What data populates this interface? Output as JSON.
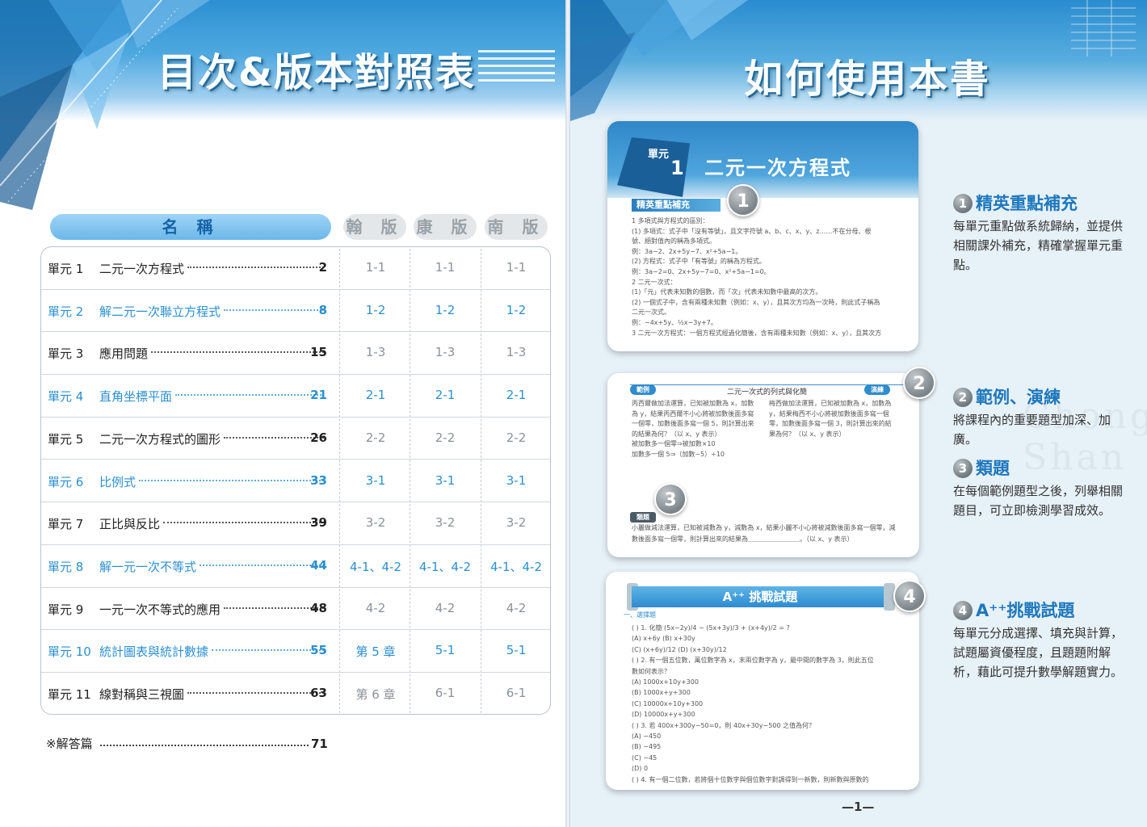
{
  "left_page": {
    "title": "目次&版本對照表",
    "headers": {
      "name": "名 稱",
      "versions": [
        "翰 版",
        "康 版",
        "南 版"
      ]
    },
    "rows": [
      {
        "unit": "單元 1",
        "title": "二元一次方程式",
        "page": "2",
        "v1": "1-1",
        "v2": "1-1",
        "v3": "1-1",
        "blue": false
      },
      {
        "unit": "單元 2",
        "title": "解二元一次聯立方程式",
        "page": "8",
        "v1": "1-2",
        "v2": "1-2",
        "v3": "1-2",
        "blue": true
      },
      {
        "unit": "單元 3",
        "title": "應用問題",
        "page": "15",
        "v1": "1-3",
        "v2": "1-3",
        "v3": "1-3",
        "blue": false
      },
      {
        "unit": "單元 4",
        "title": "直角坐標平面",
        "page": "21",
        "v1": "2-1",
        "v2": "2-1",
        "v3": "2-1",
        "blue": true
      },
      {
        "unit": "單元 5",
        "title": "二元一次方程式的圖形",
        "page": "26",
        "v1": "2-2",
        "v2": "2-2",
        "v3": "2-2",
        "blue": false
      },
      {
        "unit": "單元 6",
        "title": "比例式",
        "page": "33",
        "v1": "3-1",
        "v2": "3-1",
        "v3": "3-1",
        "blue": true
      },
      {
        "unit": "單元 7",
        "title": "正比與反比",
        "page": "39",
        "v1": "3-2",
        "v2": "3-2",
        "v3": "3-2",
        "blue": false
      },
      {
        "unit": "單元 8",
        "title": "解一元一次不等式",
        "page": "44",
        "v1": "4-1、4-2",
        "v2": "4-1、4-2",
        "v3": "4-1、4-2",
        "blue": true
      },
      {
        "unit": "單元 9",
        "title": "一元一次不等式的應用",
        "page": "48",
        "v1": "4-2",
        "v2": "4-2",
        "v3": "4-2",
        "blue": false
      },
      {
        "unit": "單元 10",
        "title": "統計圖表與統計數據",
        "page": "55",
        "v1": "第 5 章",
        "v2": "5-1",
        "v3": "5-1",
        "blue": true
      },
      {
        "unit": "單元 11",
        "title": "線對稱與三視圖",
        "page": "63",
        "v1": "第 6 章",
        "v2": "6-1",
        "v3": "6-1",
        "blue": false
      }
    ],
    "answer_label": "※解答篇",
    "answer_page": "71"
  },
  "right_page": {
    "title": "如何使用本書",
    "page_number": "—1—",
    "watermark": "Chong Shan",
    "card1": {
      "unit_label": "單元",
      "unit_number": "1",
      "title": "二元一次方程式",
      "section_label": "精英重點補充",
      "lines": [
        "1 多項式與方程式的區別：",
        "(1) 多項式：式子中「沒有等號」，且文字符號 a、b、c、x、y、z……不在分母、根",
        "號、絕對值內的稱為多項式。",
        "例：3a−2、2x+5y−7、x²+5a−1。",
        "(2) 方程式：式子中「有等號」的稱為方程式。",
        "例：3a−2=0、2x+5y−7=0、x²+5a−1=0。",
        "2 二元一次式：",
        "(1)「元」代表未知數的個數，而「次」代表未知數中最高的次方。",
        "(2) 一個式子中，含有兩種未知數（例如：x、y），且其次方均為一次時，則此式子稱為",
        "二元一次式。",
        "例：−4x+5y、½x−3y+7。",
        "3 二元一次方程式：一個方程式經過化簡後，含有兩種未知數（例如：x、y），且其次方"
      ]
    },
    "card2": {
      "tag_left": "範例",
      "mid_title": "二元一次式的列式與化簡",
      "tag_right": "演練",
      "col_left": [
        "丙西爾做加法運算，已知被加數為 x，加數",
        "為 y，結果丙西爾不小心將被加數後面多寫",
        "一個零，加數後面多寫一個 5，則計算出來",
        "的結果為何？（以 x、y 表示）",
        "被加數多一個零⇒被加數×10",
        "加數多一個 5⇒（加數−5）÷10"
      ],
      "col_right": [
        "梅西做加法運算，已知被加數為 x，加數為",
        "y，結果梅西不小心將被加數後面多寫一個",
        "零，加數後面多寫一個 3，則計算出來的結",
        "果為何？（以 x、y 表示）"
      ],
      "class_label": "類題",
      "class_lines": [
        "小麗做減法運算，已知被減數為 y，減數為 x，結果小麗不小心將被減數後面多寫一個零，減",
        "數後面多寫一個零，則計算出來的結果為＿＿＿＿＿＿＿＿。（以 x、y 表示）"
      ]
    },
    "card3": {
      "banner": "A⁺⁺ 挑戰試題",
      "section": "一、選擇題",
      "lines": [
        "(   ) 1. 化簡 (5x−2y)/4 − (5x+3y)/3 + (x+4y)/2 = ?",
        "(A) x+6y      (B) x+30y",
        "(C) (x+6y)/12   (D) (x+30y)/12",
        "(   ) 2. 有一個五位數，萬位數字為 x，末兩位數字為 y，最中間的數字為 3，則此五位",
        "數如何表示？",
        "(A) 1000x+10y+300",
        "(B) 1000x+y+300",
        "(C) 10000x+10y+300",
        "(D) 10000x+y+300",
        "(   ) 3. 若 400x+300y−50=0，則 40x+30y−500 之值為何？",
        "(A) −450",
        "(B) −495",
        "(C) −45",
        "(D) 0",
        "(   ) 4. 有一個二位數，若將個十位數字與個位數字對調得到一新數，則新數與原數的"
      ]
    },
    "badges": [
      "1",
      "2",
      "3",
      "4"
    ],
    "features": [
      {
        "num": "1",
        "title": "精英重點補充",
        "text": "每單元重點做系統歸納，並提供相關課外補充，精確掌握單元重點。"
      },
      {
        "num": "2",
        "title": "範例、演練",
        "text": "將課程內的重要題型加深、加廣。"
      },
      {
        "num": "3",
        "title": "類題",
        "text": "在每個範例題型之後，列舉相關題目，可立即檢測學習成效。"
      },
      {
        "num": "4",
        "title": "A⁺⁺挑戰試題",
        "text": "每單元分成選擇、填充與計算，試題屬資優程度，且題題附解析，藉此可提升數學解題實力。"
      }
    ]
  },
  "colors": {
    "accent_blue": "#2b8fd1",
    "header_blue": "#2c8fd1",
    "dark_blue": "#1e78bd"
  }
}
